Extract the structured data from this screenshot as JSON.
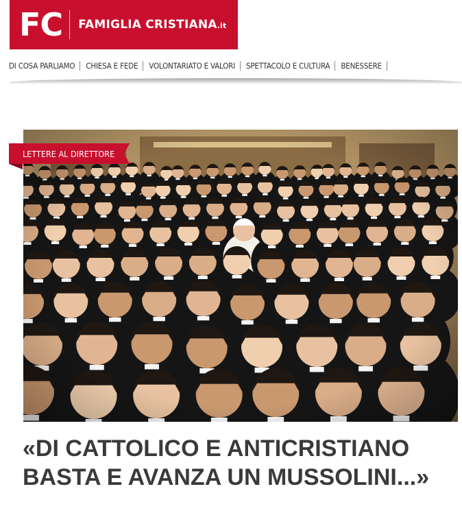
{
  "logo": {
    "initials": "FC",
    "name": "FAMIGLIA CRISTIANA",
    "tld": ".it",
    "brand_color": "#c8102e"
  },
  "nav": {
    "items": [
      {
        "label": "DI COSA PARLIAMO"
      },
      {
        "label": "CHIESA E FEDE"
      },
      {
        "label": "VOLONTARIATO E VALORI"
      },
      {
        "label": "SPETTACOLO E CULTURA"
      },
      {
        "label": "BENESSERE"
      }
    ]
  },
  "article": {
    "section_label": "LETTERE AL DIRETTORE",
    "headline": "«DI CATTOLICO E ANTICRISTIANO BASTA E AVANZA UN MUSSOLINI...»",
    "headline_color": "#3a3a3a",
    "image": "group-photo"
  }
}
